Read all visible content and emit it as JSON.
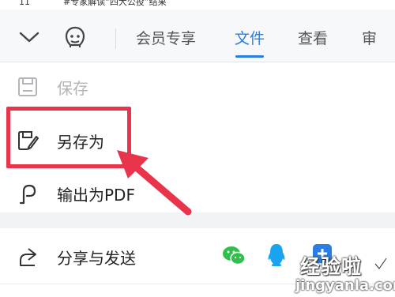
{
  "header_cutoff": {
    "number": "11",
    "title": "#专家解读“四大公投”结果"
  },
  "menubar": {
    "tabs": [
      {
        "label": "会员专享"
      },
      {
        "label": "文件"
      },
      {
        "label": "查看"
      },
      {
        "label": "审"
      }
    ],
    "active_tab": "文件"
  },
  "file_menu": {
    "items": [
      {
        "label": "保存",
        "icon": "save-icon",
        "disabled": true
      },
      {
        "label": "另存为",
        "icon": "save-as-icon",
        "disabled": false
      },
      {
        "label": "输出为PDF",
        "icon": "export-pdf-icon",
        "disabled": false
      }
    ]
  },
  "share": {
    "label": "分享与发送",
    "icon": "share-icon",
    "apps": [
      "wechat-icon",
      "qq-icon",
      "tim-icon"
    ]
  },
  "watermark": {
    "brand": "经验啦",
    "url": "jingyanla.com"
  },
  "colors": {
    "accent": "#2a7de1",
    "highlight": "#e8354c",
    "wechat": "#2fbf4a",
    "qq": "#1aa3ef"
  }
}
